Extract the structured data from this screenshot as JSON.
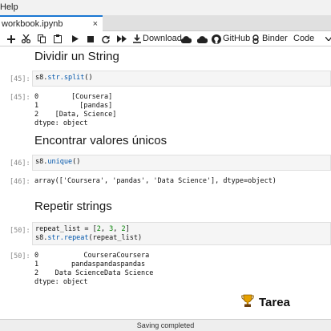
{
  "menu": {
    "help_label": "Help"
  },
  "tab": {
    "title": "workbook.ipynb",
    "close_glyph": "×"
  },
  "toolbar": {
    "download_label": "Download",
    "github_label": "GitHub",
    "binder_label": "Binder",
    "kernel_type": "Code"
  },
  "sections": [
    {
      "heading": "Dividir un String",
      "in_prompt": "[45]:",
      "code_prefix": "s8.",
      "code_method": "str.split",
      "code_suffix": "()",
      "out_prompt": "[45]:",
      "output": "0        [Coursera]\n1          [pandas]\n2    [Data, Science]\ndtype: object"
    },
    {
      "heading": "Encontrar valores únicos",
      "in_prompt": "[46]:",
      "code_prefix": "s8.",
      "code_method": "unique",
      "code_suffix": "()",
      "out_prompt": "[46]:",
      "output": "array(['Coursera', 'pandas', 'Data Science'], dtype=object)"
    },
    {
      "heading": "Repetir strings",
      "in_prompt": "[50]:",
      "code_line1_a": "repeat_list = [",
      "code_line1_nums": [
        "2",
        "3",
        "2"
      ],
      "code_line1_b": "]",
      "code_line2_prefix": "s8.",
      "code_line2_method": "str.repeat",
      "code_line2_suffix": "(repeat_list)",
      "out_prompt": "[50]:",
      "output": "0           CourseraCoursera\n1        pandaspandaspandas\n2    Data ScienceData Science\ndtype: object"
    }
  ],
  "tarea": {
    "label": "Tarea",
    "icon": "trophy-icon"
  },
  "status": {
    "text": "Saving completed"
  },
  "colors": {
    "accent": "#1976d2",
    "code_blue": "#0055aa",
    "number_green": "#008000"
  }
}
